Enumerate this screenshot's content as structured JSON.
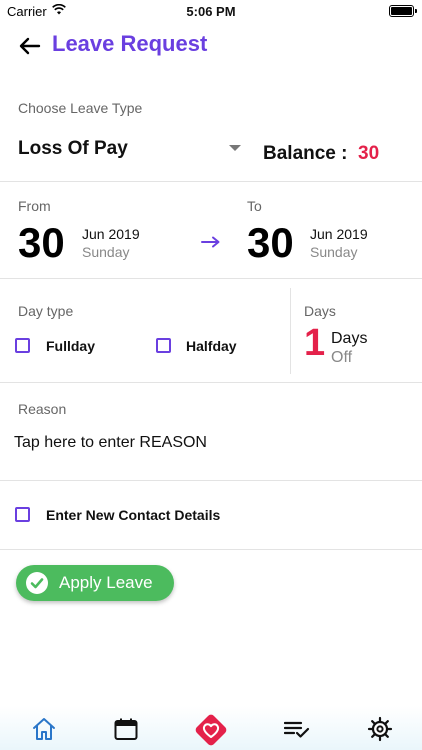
{
  "status_bar": {
    "carrier": "Carrier",
    "time": "5:06 PM"
  },
  "header": {
    "title": "Leave Request"
  },
  "leave_type": {
    "label": "Choose Leave Type",
    "value": "Loss Of Pay",
    "balance_label": "Balance :",
    "balance_value": "30"
  },
  "dates": {
    "from": {
      "label": "From",
      "day": "30",
      "month_year": "Jun 2019",
      "weekday": "Sunday"
    },
    "to": {
      "label": "To",
      "day": "30",
      "month_year": "Jun 2019",
      "weekday": "Sunday"
    }
  },
  "day_type": {
    "label": "Day type",
    "options": [
      {
        "label": "Fullday",
        "checked": false
      },
      {
        "label": "Halfday",
        "checked": false
      }
    ]
  },
  "days": {
    "label": "Days",
    "count": "1",
    "word": "Days",
    "sub": "Off"
  },
  "reason": {
    "label": "Reason",
    "placeholder": "Tap here to enter  REASON"
  },
  "contact": {
    "label": "Enter New Contact Details",
    "checked": false
  },
  "apply_button": {
    "label": "Apply Leave"
  },
  "colors": {
    "accent": "#6a3fe0",
    "highlight": "#e4214a",
    "success": "#4cbb5e"
  },
  "tabbar": {
    "items": [
      "home-icon",
      "calendar-icon",
      "heart-icon",
      "checklist-icon",
      "gear-icon"
    ]
  }
}
